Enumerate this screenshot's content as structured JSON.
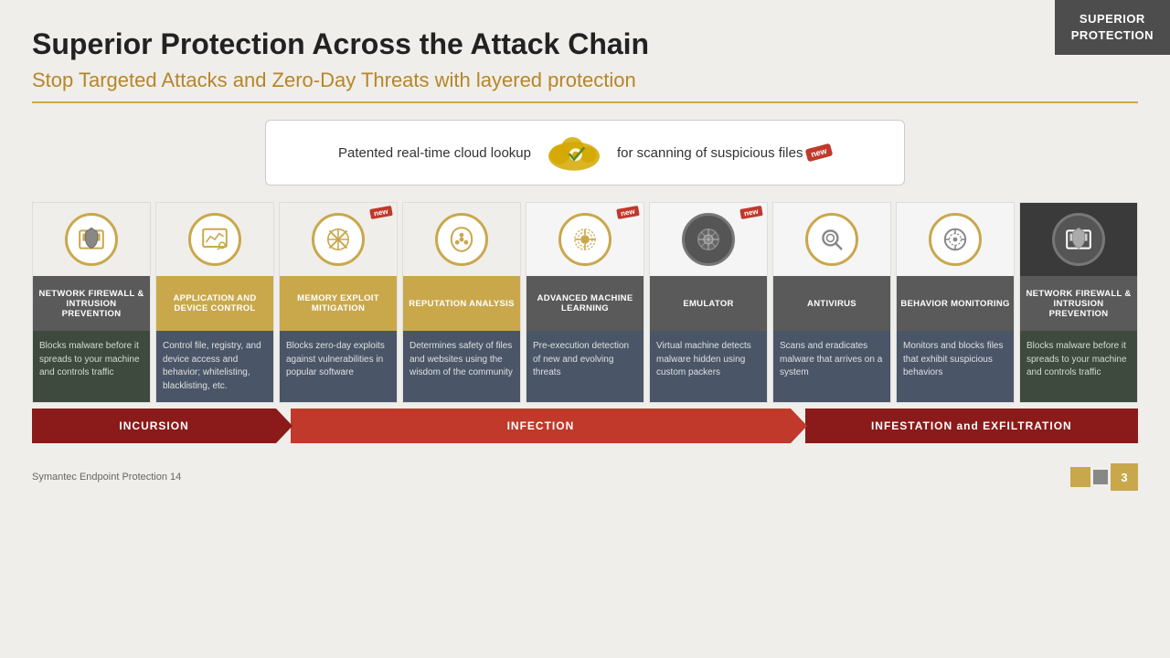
{
  "badge": {
    "line1": "SUPERIOR",
    "line2": "PROTECTION"
  },
  "header": {
    "title": "Superior Protection Across the Attack Chain",
    "subtitle": "Stop Targeted Attacks and Zero-Day Threats with layered protection"
  },
  "cloud_banner": {
    "text_before": "Patented real-time cloud lookup",
    "text_after": "for scanning of suspicious files",
    "new_label": "new"
  },
  "columns": [
    {
      "id": "nfip1",
      "title": "NETWORK FIREWALL & INTRUSION PREVENTION",
      "desc": "Blocks malware before it spreads to your machine and controls traffic",
      "icon": "🛡",
      "is_new": false,
      "dark_icon": false,
      "style": "first"
    },
    {
      "id": "adc",
      "title": "APPLICATION AND DEVICE CONTROL",
      "desc": "Control file, registry, and device access and behavior; whitelisting, blacklisting, etc.",
      "icon": "📊",
      "is_new": false,
      "dark_icon": false,
      "style": "normal"
    },
    {
      "id": "mem",
      "title": "MEMORY EXPLOIT MITIGATION",
      "desc": "Blocks zero-day exploits against vulnerabilities in popular software",
      "icon": "⚔",
      "is_new": true,
      "dark_icon": false,
      "style": "normal"
    },
    {
      "id": "rep",
      "title": "REPUTATION ANALYSIS",
      "desc": "Determines safety of files and websites using the wisdom of the community",
      "icon": "🖐",
      "is_new": false,
      "dark_icon": false,
      "style": "normal"
    },
    {
      "id": "aml",
      "title": "ADVANCED MACHINE LEARNING",
      "desc": "Pre-execution detection of new and evolving threats",
      "icon": "⚙",
      "is_new": true,
      "dark_icon": false,
      "style": "highlighted"
    },
    {
      "id": "emu",
      "title": "EMULATOR",
      "desc": "Virtual machine detects malware hidden using custom packers",
      "icon": "🎯",
      "is_new": true,
      "dark_icon": true,
      "style": "highlighted"
    },
    {
      "id": "av",
      "title": "ANTIVIRUS",
      "desc": "Scans and eradicates malware that arrives on a system",
      "icon": "🔍",
      "is_new": false,
      "dark_icon": false,
      "style": "highlighted"
    },
    {
      "id": "bm",
      "title": "BEHAVIOR MONITORING",
      "desc": "Monitors and blocks files that exhibit suspicious behaviors",
      "icon": "📡",
      "is_new": false,
      "dark_icon": false,
      "style": "highlighted"
    },
    {
      "id": "nfip2",
      "title": "NETWORK FIREWALL & INTRUSION PREVENTION",
      "desc": "Blocks malware before it spreads to your machine and controls traffic",
      "icon": "🛡",
      "is_new": false,
      "dark_icon": false,
      "style": "last"
    }
  ],
  "attack_chain": {
    "incursion": "INCURSION",
    "infection": "INFECTION",
    "infestation": "INFESTATION and EXFILTRATION"
  },
  "footer": {
    "brand": "Symantec Endpoint Protection 14",
    "page": "3"
  }
}
